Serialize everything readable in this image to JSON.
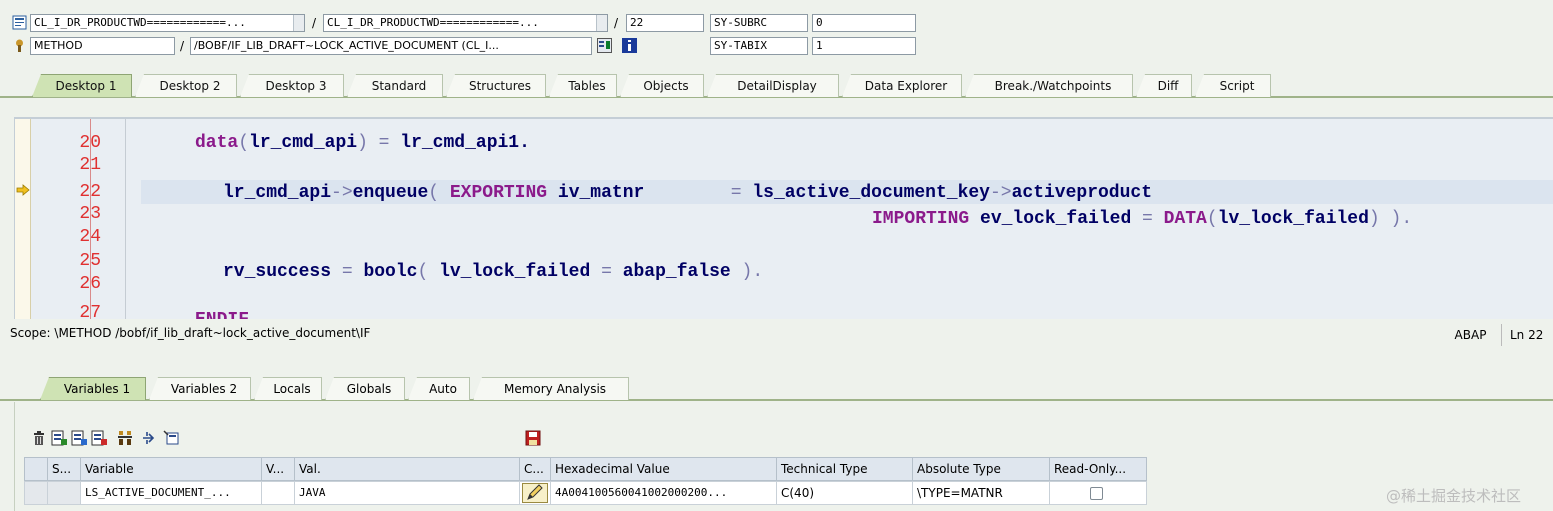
{
  "header": {
    "row1": {
      "program_field": "CL_I_DR_PRODUCTWD============...",
      "include_field": "CL_I_DR_PRODUCTWD============...",
      "line_field": "22",
      "sy_label": "SY-SUBRC",
      "sy_value": "0"
    },
    "row2": {
      "type_field": "METHOD",
      "name_field": "/BOBF/IF_LIB_DRAFT~LOCK_ACTIVE_DOCUMENT (CL_I...",
      "sy_label": "SY-TABIX",
      "sy_value": "1"
    },
    "slash": "/"
  },
  "desktop_tabs": [
    "Desktop 1",
    "Desktop 2",
    "Desktop 3",
    "Standard",
    "Structures",
    "Tables",
    "Objects",
    "DetailDisplay",
    "Data Explorer",
    "Break./Watchpoints",
    "Diff",
    "Script"
  ],
  "code": {
    "line_numbers": [
      "20",
      "21",
      "22",
      "23",
      "24",
      "25",
      "26",
      "27"
    ],
    "line20": {
      "kw": "data",
      "p1": "(",
      "var": "lr_cmd_api",
      "p2": ")",
      "eq": " = ",
      "val": "lr_cmd_api1",
      "end": "."
    },
    "line22": {
      "obj": "lr_cmd_api",
      "arrow": "->",
      "meth": "enqueue",
      "p1": "( ",
      "kw": "EXPORTING",
      "param": " iv_matnr",
      "eq": "        = ",
      "val": "ls_active_document_key",
      "arrow2": "->",
      "field": "activeproduct"
    },
    "line23": {
      "kw": "IMPORTING",
      "param": " ev_lock_failed",
      "eq": " = ",
      "kw2": "DATA",
      "p1": "(",
      "var": "lv_lock_failed",
      "p2": ") ).",
      "end": ""
    },
    "line25": {
      "var": "rv_success",
      "eq": " = ",
      "fn": "boolc",
      "p1": "( ",
      "arg": "lv_lock_failed",
      "eq2": " = ",
      "val": "abap_false",
      "p2": " ).",
      "end": ""
    },
    "line27": "ENDIF."
  },
  "scope": {
    "text": "Scope: \\METHOD /bobf/if_lib_draft~lock_active_document\\IF",
    "language": "ABAP",
    "position": "Ln 22"
  },
  "variable_tabs": [
    "Variables 1",
    "Variables 2",
    "Locals",
    "Globals",
    "Auto",
    "Memory Analysis"
  ],
  "table": {
    "headers": [
      "S...",
      "Variable",
      "V...",
      "Val.",
      "C...",
      "Hexadecimal Value",
      "Technical Type",
      "Absolute Type",
      "Read-Only..."
    ],
    "row": {
      "variable": "LS_ACTIVE_DOCUMENT_...",
      "val": "JAVA",
      "hex": "4A004100560041002000200...",
      "tech_type": "C(40)",
      "abs_type": "\\TYPE=MATNR"
    }
  },
  "watermark": "@稀土掘金技术社区",
  "colors": {
    "accent_tab": "#cfe3b4",
    "line_numbers": "#e03030",
    "keyword": "#8b1a8b",
    "code_text": "#000064"
  }
}
